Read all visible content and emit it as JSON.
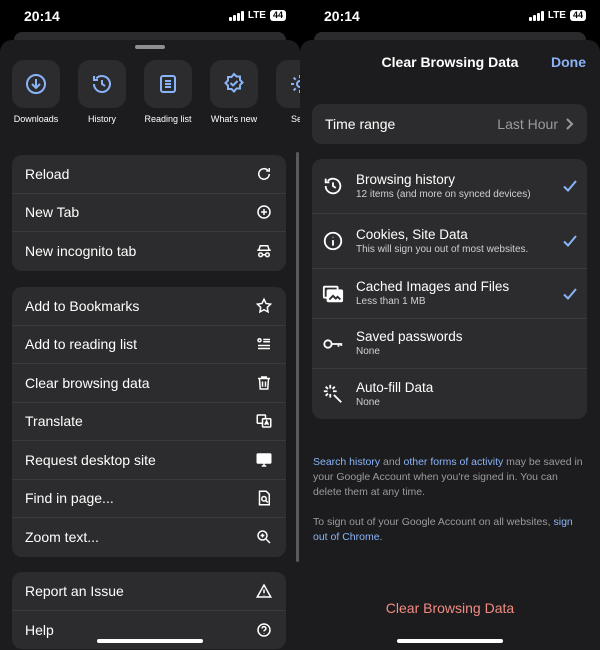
{
  "left": {
    "status": {
      "time": "20:14",
      "network": "LTE",
      "battery": "44"
    },
    "shortcuts": [
      {
        "label": "Downloads",
        "icon": "download-icon"
      },
      {
        "label": "History",
        "icon": "history-icon"
      },
      {
        "label": "Reading list",
        "icon": "reading-list-icon"
      },
      {
        "label": "What's new",
        "icon": "whats-new-badge-icon"
      },
      {
        "label": "Setti",
        "icon": "settings-gear-icon"
      }
    ],
    "group1": [
      {
        "label": "Reload",
        "icon": "reload-icon"
      },
      {
        "label": "New Tab",
        "icon": "plus-circle-icon"
      },
      {
        "label": "New incognito tab",
        "icon": "incognito-icon"
      }
    ],
    "group2": [
      {
        "label": "Add to Bookmarks",
        "icon": "star-icon"
      },
      {
        "label": "Add to reading list",
        "icon": "reading-list-add-icon"
      },
      {
        "label": "Clear browsing data",
        "icon": "trash-icon"
      },
      {
        "label": "Translate",
        "icon": "translate-icon"
      },
      {
        "label": "Request desktop site",
        "icon": "desktop-icon"
      },
      {
        "label": "Find in page...",
        "icon": "find-in-page-icon"
      },
      {
        "label": "Zoom text...",
        "icon": "zoom-icon"
      }
    ],
    "group3": [
      {
        "label": "Report an Issue",
        "icon": "warning-icon"
      },
      {
        "label": "Help",
        "icon": "help-icon"
      }
    ]
  },
  "right": {
    "status": {
      "time": "20:14",
      "network": "LTE",
      "battery": "44"
    },
    "title": "Clear Browsing Data",
    "done_label": "Done",
    "time_range": {
      "label": "Time range",
      "value": "Last Hour"
    },
    "items": [
      {
        "title": "Browsing history",
        "subtitle": "12 items (and more on synced devices)",
        "icon": "history-icon",
        "checked": true
      },
      {
        "title": "Cookies, Site Data",
        "subtitle": "This will sign you out of most websites.",
        "icon": "info-icon",
        "checked": true
      },
      {
        "title": "Cached Images and Files",
        "subtitle": "Less than 1 MB",
        "icon": "images-icon",
        "checked": true
      },
      {
        "title": "Saved passwords",
        "subtitle": "None",
        "icon": "key-icon",
        "checked": false
      },
      {
        "title": "Auto-fill Data",
        "subtitle": "None",
        "icon": "autofill-sparkle-icon",
        "checked": false
      }
    ],
    "info1": {
      "link1": "Search history",
      "mid": " and ",
      "link2": "other forms of activity",
      "rest": " may be saved in your Google Account when you're signed in. You can delete them at any time."
    },
    "info2": {
      "text": "To sign out of your Google Account on all websites, ",
      "link": "sign out of Chrome."
    },
    "clear_button": "Clear Browsing Data"
  },
  "colors": {
    "accent": "#8ab4f8",
    "destructive": "#f28b82",
    "sheet": "#1c1c1e",
    "cell": "#2c2c2e"
  }
}
